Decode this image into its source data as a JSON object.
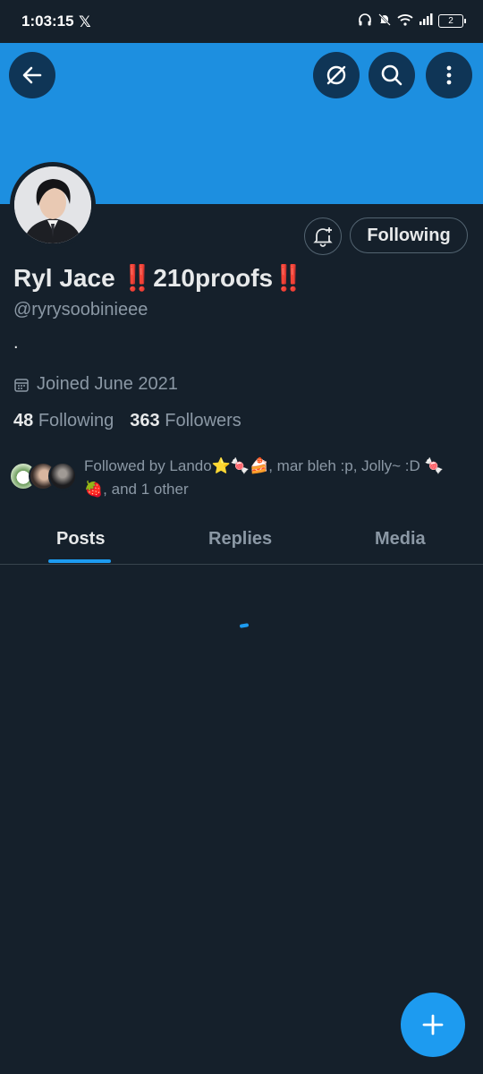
{
  "status_bar": {
    "time": "1:03:15",
    "app_icon": "x-logo",
    "battery": "2"
  },
  "header": {
    "back_icon": "arrow-left-icon",
    "actions": [
      "explore-icon",
      "search-icon",
      "more-vertical-icon"
    ],
    "banner_color": "#1d8fe0"
  },
  "profile": {
    "name": "Ryl Jace ‼️210proofs‼️",
    "handle": "@ryrysoobinieee",
    "bio": ".",
    "joined": "Joined June 2021",
    "following_count": "48",
    "following_label": "Following",
    "followers_count": "363",
    "followers_label": "Followers",
    "followed_by": "Followed by Lando⭐🍬🍰, mar bleh :p, Jolly~ :D 🍬🍓, and 1 other"
  },
  "actions": {
    "notify_icon": "bell-plus-icon",
    "follow_state": "Following"
  },
  "tabs": [
    {
      "label": "Posts",
      "active": true
    },
    {
      "label": "Replies",
      "active": false
    },
    {
      "label": "Media",
      "active": false
    }
  ],
  "colors": {
    "background": "#15202b",
    "accent": "#1d9bf0",
    "muted_text": "#8b98a5"
  },
  "fab": {
    "icon": "plus-icon"
  }
}
